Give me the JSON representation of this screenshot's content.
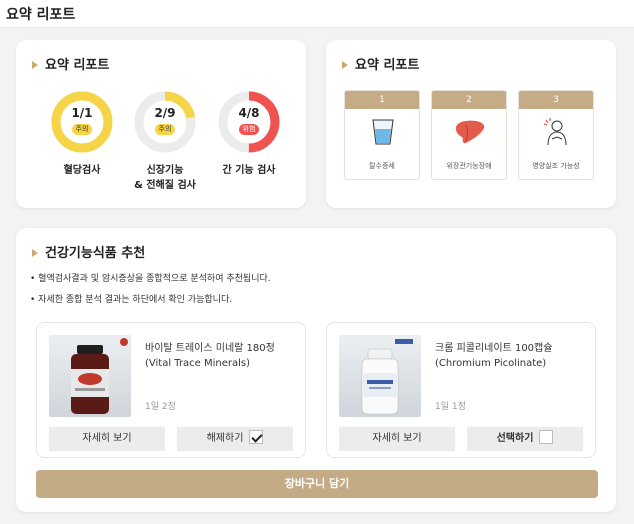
{
  "header": {
    "title": "요약 리포트"
  },
  "summary_left": {
    "title": "요약 리포트",
    "items": [
      {
        "value": "1/1",
        "badge": "주의",
        "label": "혈당검사",
        "label2": "",
        "fraction": 1.0,
        "color": "#f5d547",
        "badge_color": "#f5d547",
        "badge_text_color": "#333333"
      },
      {
        "value": "2/9",
        "badge": "주의",
        "label": "신장기능",
        "label2": "& 전해질 검사",
        "fraction": 0.222,
        "color": "#f5d547",
        "badge_color": "#f5d547",
        "badge_text_color": "#333333"
      },
      {
        "value": "4/8",
        "badge": "위험",
        "label": "간 기능 검사",
        "label2": "",
        "fraction": 0.5,
        "color": "#ef5350",
        "badge_color": "#ef5350",
        "badge_text_color": "#ffffff"
      }
    ]
  },
  "summary_right": {
    "title": "요약 리포트",
    "items": [
      {
        "num": "1",
        "label": "탈수증세",
        "icon": "water-glass-icon"
      },
      {
        "num": "2",
        "label": "위장관기능장애",
        "icon": "liver-icon"
      },
      {
        "num": "3",
        "label": "영양실조 가능성",
        "icon": "malnutrition-icon"
      }
    ]
  },
  "recommend": {
    "title": "건강기능식품 추천",
    "bullets": [
      "혈액검사결과 및 암시증상을 종합적으로 분석하여 추천됩니다.",
      "자세한 종합 분석 결과는 하단에서 확인 가능합니다."
    ],
    "products": [
      {
        "name1": "바이탈 트레이스 미네랄 180정",
        "name2": "(Vital Trace Minerals)",
        "dose": "1일 2정",
        "detail_label": "자세히 보기",
        "select_label": "해제하기",
        "selected": true
      },
      {
        "name1": "크롬 피콜리네이트 100캡슐",
        "name2": "(Chromium Picolinate)",
        "dose": "1일 1정",
        "detail_label": "자세히 보기",
        "select_label": "선택하기",
        "selected": false
      }
    ],
    "cart_label": "장바구니 담기"
  },
  "colors": {
    "accent": "#c2ab85",
    "warning": "#f5d547",
    "danger": "#ef5350"
  }
}
